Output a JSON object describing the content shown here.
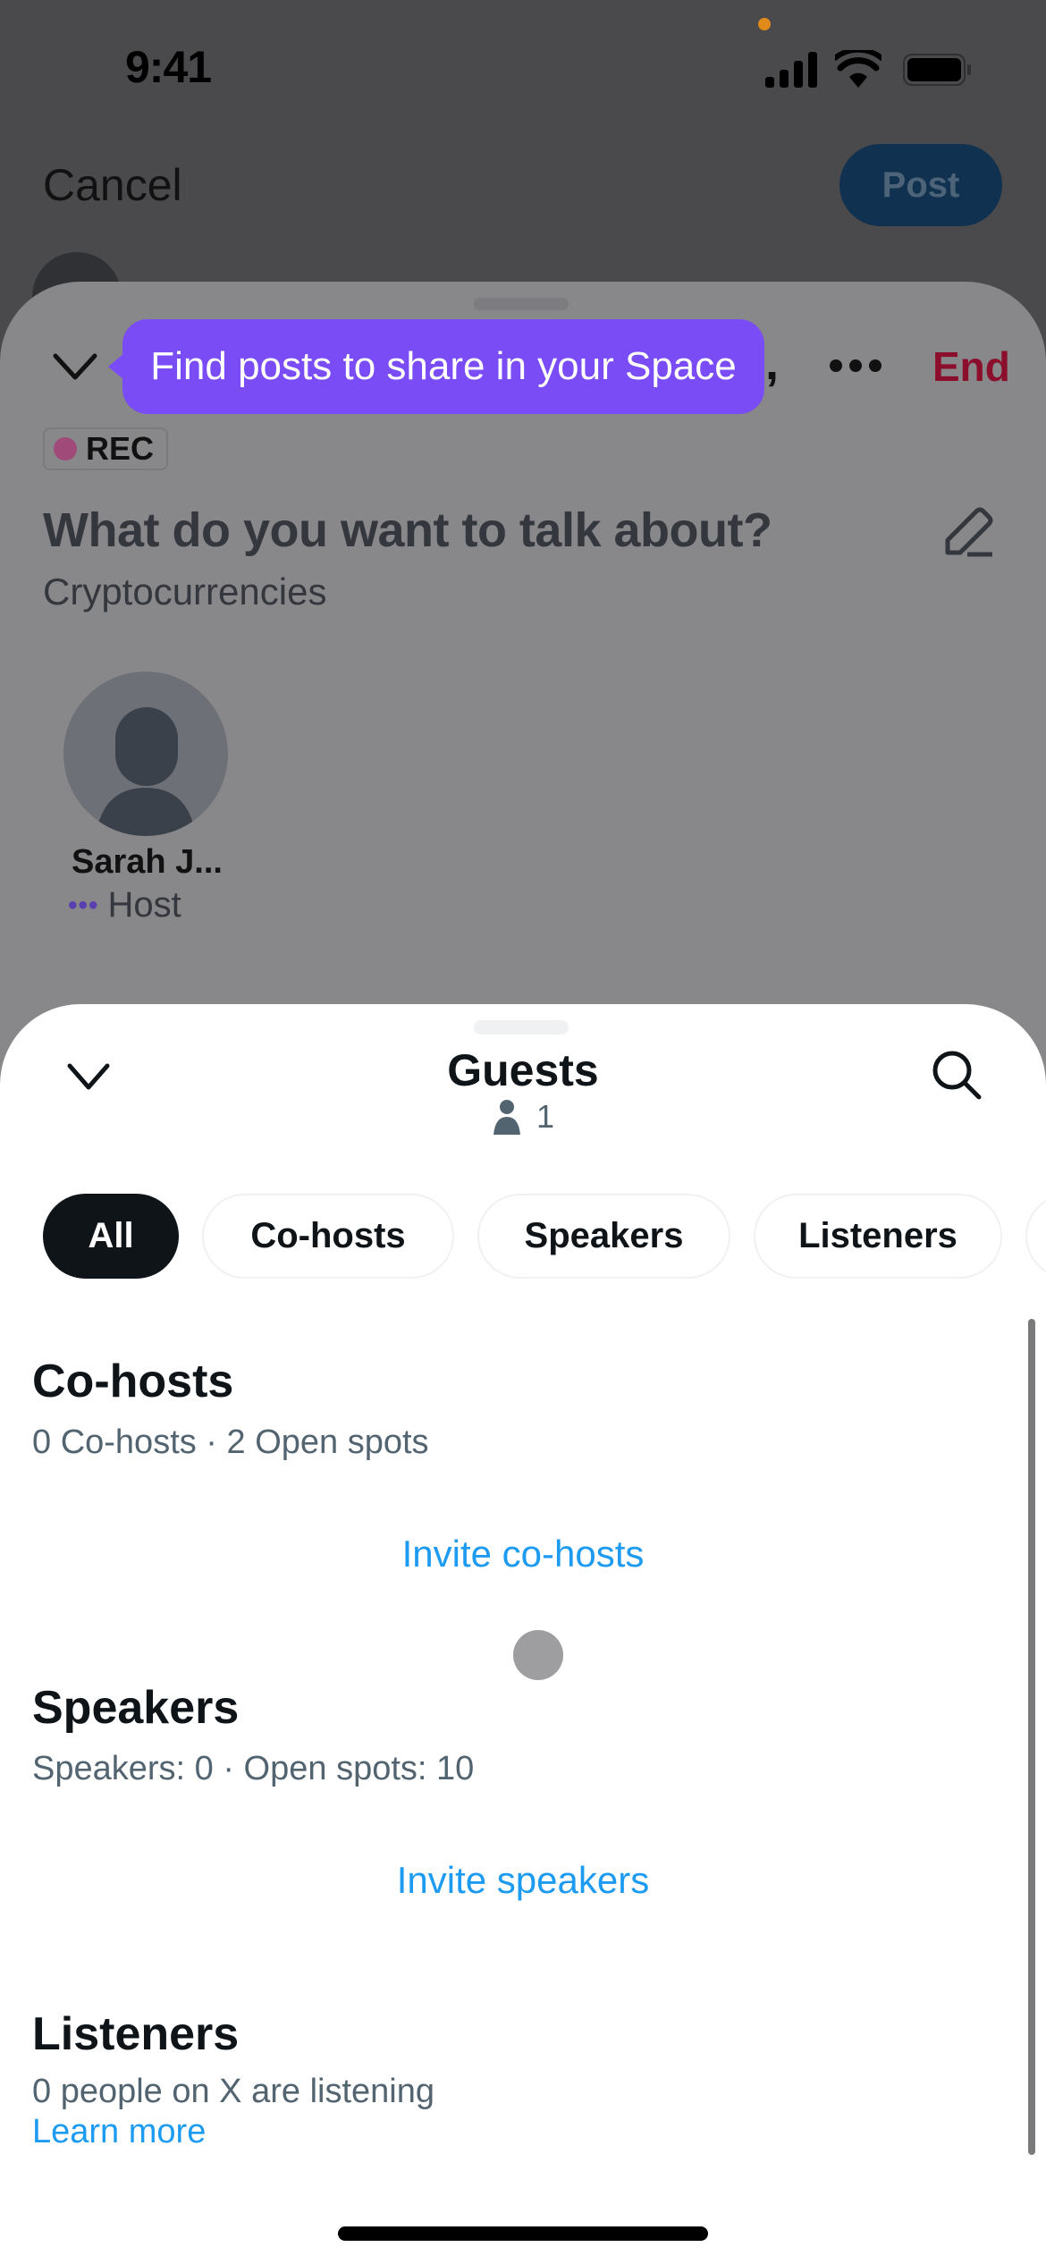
{
  "status_bar": {
    "time": "9:41",
    "icons": [
      "camera-indicator-dot",
      "cellular-signal-icon",
      "wifi-icon",
      "battery-icon"
    ]
  },
  "compose": {
    "cancel_label": "Cancel",
    "post_label": "Post"
  },
  "space": {
    "tooltip": "Find posts to share in your Space",
    "hidden_title_tail": ",",
    "end_label": "End",
    "rec_label": "REC",
    "title": "What do you want to talk about?",
    "topic": "Cryptocurrencies",
    "host": {
      "name": "Sarah J...",
      "role_dots": "•••",
      "role": "Host"
    }
  },
  "guests_sheet": {
    "title": "Guests",
    "count": "1",
    "filters": [
      {
        "label": "All",
        "active": true
      },
      {
        "label": "Co-hosts",
        "active": false
      },
      {
        "label": "Speakers",
        "active": false
      },
      {
        "label": "Listeners",
        "active": false
      }
    ],
    "sections": {
      "cohosts": {
        "title": "Co-hosts",
        "subtitle": "0 Co-hosts · 2 Open spots",
        "action": "Invite co-hosts"
      },
      "speakers": {
        "title": "Speakers",
        "subtitle": "Speakers: 0 · Open spots: 10",
        "action": "Invite speakers"
      },
      "listeners": {
        "title": "Listeners",
        "subtitle": "0 people on X are listening",
        "action": "Learn more"
      }
    }
  },
  "colors": {
    "accent_blue": "#1d9bf0",
    "tooltip_purple": "#7a4cf5",
    "end_red": "#8b0f2c",
    "rec_dot": "#a04a7a",
    "text_primary": "#0f1419",
    "text_secondary": "#536471"
  }
}
